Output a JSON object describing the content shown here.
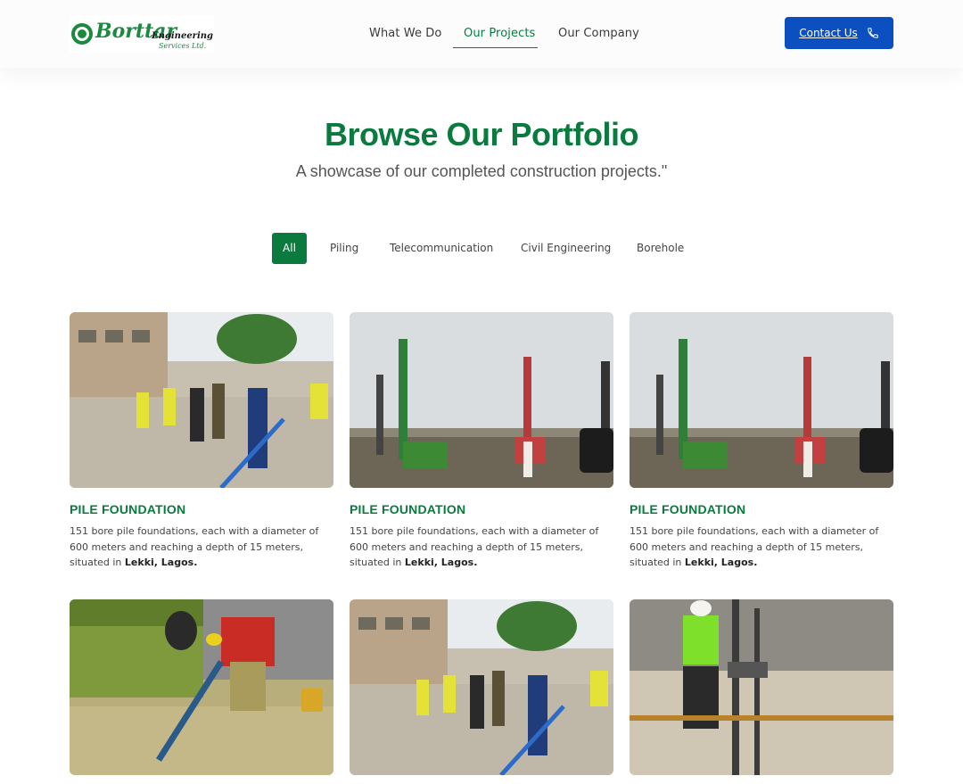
{
  "header": {
    "logo_text": "Borttar",
    "logo_subtext": "Engineering",
    "logo_subtext2": "Services Ltd.",
    "nav": [
      {
        "label": "What We Do"
      },
      {
        "label": "Our Projects"
      },
      {
        "label": "Our Company"
      }
    ],
    "active_nav": "Our Projects",
    "contact_label": "Contact Us",
    "contact_icon": "phone-icon"
  },
  "hero": {
    "title": "Browse Our Portfolio",
    "subtitle": "A showcase of our completed construction projects.\""
  },
  "filters": {
    "items": [
      {
        "label": "All"
      },
      {
        "label": "Piling"
      },
      {
        "label": "Telecommunication"
      },
      {
        "label": "Civil Engineering"
      },
      {
        "label": "Borehole"
      }
    ],
    "active": "All"
  },
  "projects": [
    {
      "title": "PILE FOUNDATION",
      "desc": "151 bore pile foundations, each with a diameter of 600 meters and reaching a depth of 15 meters, situated in ",
      "location": "Lekki, Lagos.",
      "image": "site-visit-photo"
    },
    {
      "title": "PILE FOUNDATION",
      "desc": "151 bore pile foundations, each with a diameter of 600 meters and reaching a depth of 15 meters, situated in ",
      "location": "Lekki, Lagos.",
      "image": "drilling-rigs-photo"
    },
    {
      "title": "PILE FOUNDATION",
      "desc": "151 bore pile foundations, each with a diameter of 600 meters and reaching a depth of 15 meters, situated in ",
      "location": "Lekki, Lagos.",
      "image": "drilling-rigs-photo"
    },
    {
      "image": "borehole-work-photo"
    },
    {
      "image": "site-visit-photo"
    },
    {
      "image": "worker-drilling-photo"
    }
  ],
  "colors": {
    "brand_green": "#0a7a3e",
    "contact_blue": "#0b4fc1"
  }
}
